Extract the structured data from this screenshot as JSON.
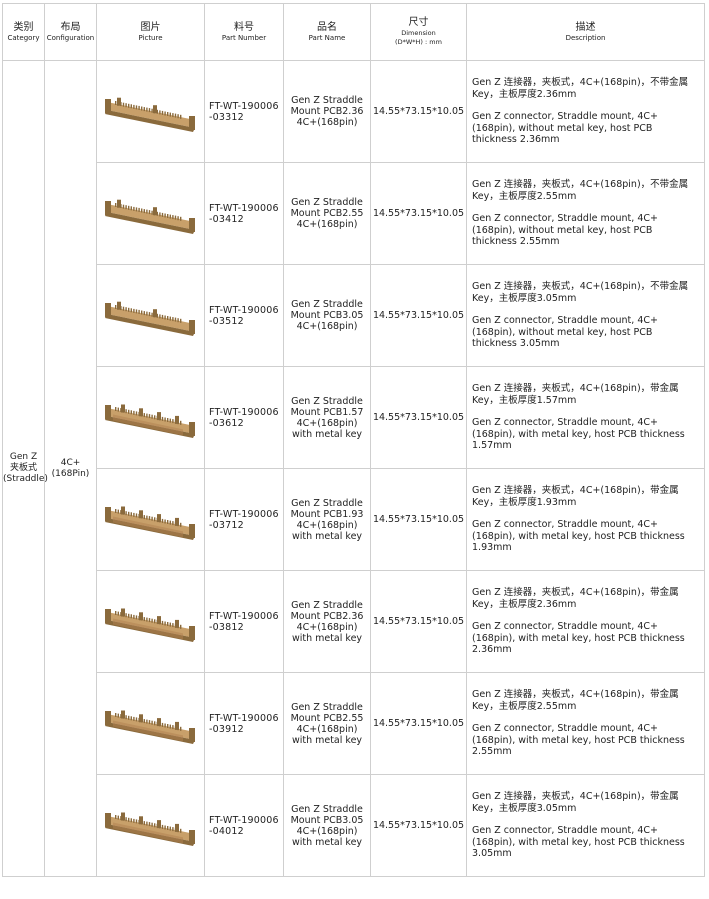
{
  "headers": {
    "category": {
      "cn": "类别",
      "en": "Category"
    },
    "configuration": {
      "cn": "布局",
      "en": "Configuration"
    },
    "picture": {
      "cn": "图片",
      "en": "Picture"
    },
    "part_number": {
      "cn": "料号",
      "en": "Part Number"
    },
    "part_name": {
      "cn": "品名",
      "en": "Part Name"
    },
    "dimension": {
      "cn": "尺寸",
      "en": "Dimension",
      "unit": "(D*W*H) : mm"
    },
    "description": {
      "cn": "描述",
      "en": "Description"
    }
  },
  "category": {
    "line1": "Gen Z",
    "line2": "夹板式",
    "line3": "(Straddle)"
  },
  "configuration": {
    "line1": "4C+",
    "line2": "(168Pin)"
  },
  "colors": {
    "connector_body": "#c8a06a",
    "connector_shadow": "#8a6a3c",
    "border": "#cfcfcf"
  },
  "rows": [
    {
      "pn1": "FT-WT-190006",
      "pn2": "-03312",
      "name": "Gen Z Straddle Mount PCB2.36 4C+(168pin)",
      "dim": "14.55*73.15*10.05",
      "cn": "Gen Z 连接器，夹板式，4C+(168pin)，不带金属Key，主板厚度2.36mm",
      "en": "Gen Z connector, Straddle mount, 4C+(168pin), without metal key, host PCB  thickness 2.36mm",
      "metal_key": false
    },
    {
      "pn1": "FT-WT-190006",
      "pn2": "-03412",
      "name": "Gen Z Straddle Mount PCB2.55 4C+(168pin)",
      "dim": "14.55*73.15*10.05",
      "cn": "Gen Z 连接器，夹板式，4C+(168pin)，不带金属Key，主板厚度2.55mm",
      "en": "Gen Z connector, Straddle mount, 4C+(168pin), without metal key, host PCB thickness 2.55mm",
      "metal_key": false
    },
    {
      "pn1": "FT-WT-190006",
      "pn2": "-03512",
      "name": "Gen Z Straddle Mount PCB3.05 4C+(168pin)",
      "dim": "14.55*73.15*10.05",
      "cn": "Gen Z 连接器，夹板式，4C+(168pin)，不带金属Key，主板厚度3.05mm",
      "en": "Gen Z connector, Straddle mount, 4C+(168pin), without metal key, host PCB thickness 3.05mm",
      "metal_key": false
    },
    {
      "pn1": "FT-WT-190006",
      "pn2": "-03612",
      "name": "Gen Z Straddle Mount PCB1.57 4C+(168pin) with metal key",
      "dim": "14.55*73.15*10.05",
      "cn": "Gen Z 连接器，夹板式，4C+(168pin)，带金属Key，主板厚度1.57mm",
      "en": "Gen Z connector, Straddle mount, 4C+(168pin), with metal key, host PCB thickness 1.57mm",
      "metal_key": true
    },
    {
      "pn1": "FT-WT-190006",
      "pn2": "-03712",
      "name": "Gen Z Straddle Mount PCB1.93 4C+(168pin) with metal key",
      "dim": "14.55*73.15*10.05",
      "cn": "Gen Z 连接器，夹板式，4C+(168pin)，带金属Key，主板厚度1.93mm",
      "en": "Gen Z connector, Straddle mount, 4C+(168pin), with metal key, host PCB thickness 1.93mm",
      "metal_key": true
    },
    {
      "pn1": "FT-WT-190006",
      "pn2": "-03812",
      "name": "Gen Z Straddle Mount PCB2.36 4C+(168pin) with metal key",
      "dim": "14.55*73.15*10.05",
      "cn": "Gen Z 连接器，夹板式，4C+(168pin)，带金属Key，主板厚度2.36mm",
      "en": "Gen Z connector, Straddle mount, 4C+(168pin), with metal key, host PCB thickness 2.36mm",
      "metal_key": true
    },
    {
      "pn1": "FT-WT-190006",
      "pn2": "-03912",
      "name": "Gen Z Straddle Mount PCB2.55 4C+(168pin) with metal key",
      "dim": "14.55*73.15*10.05",
      "cn": "Gen Z 连接器，夹板式，4C+(168pin)，带金属Key，主板厚度2.55mm",
      "en": "Gen Z connector, Straddle mount, 4C+(168pin), with metal key, host PCB thickness 2.55mm",
      "metal_key": true
    },
    {
      "pn1": "FT-WT-190006",
      "pn2": "-04012",
      "name": "Gen Z Straddle Mount PCB3.05 4C+(168pin) with metal key",
      "dim": "14.55*73.15*10.05",
      "cn": "Gen Z 连接器，夹板式，4C+(168pin)，带金属Key，主板厚度3.05mm",
      "en": "Gen Z connector, Straddle mount, 4C+(168pin), with metal key, host PCB thickness 3.05mm",
      "metal_key": true
    }
  ]
}
